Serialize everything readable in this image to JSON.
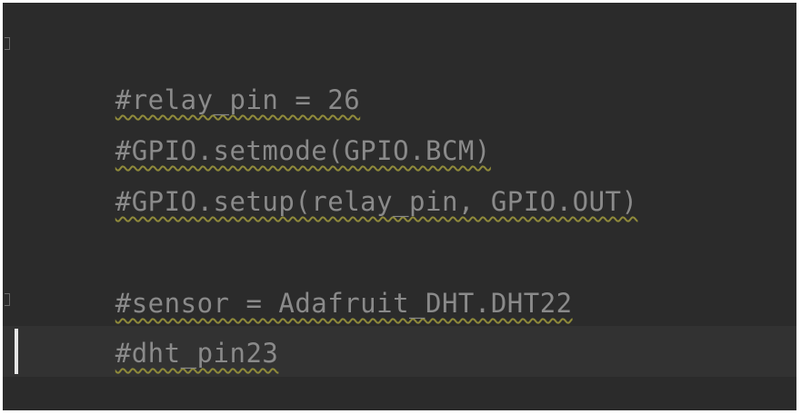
{
  "editor": {
    "lines": [
      "#relay_pin = 26",
      "#GPIO.setmode(GPIO.BCM)",
      "#GPIO.setup(relay_pin, GPIO.OUT)",
      "",
      "#sensor = Adafruit_DHT.DHT22",
      "#dht_pin23",
      ""
    ]
  },
  "colors": {
    "background": "#2b2b2b",
    "comment_text": "#8a8a8a",
    "squiggle": "#8f8a3a",
    "current_line": "#323232",
    "caret": "#e6e6e6"
  }
}
